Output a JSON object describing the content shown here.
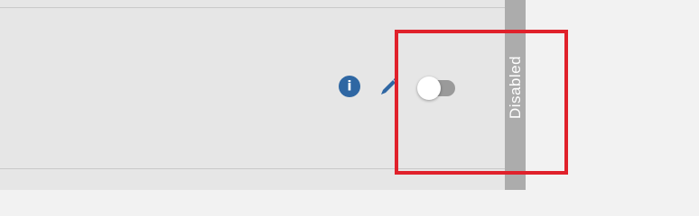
{
  "row": {
    "actions": {
      "info_icon": "info-icon",
      "edit_icon": "pencil-icon",
      "toggle": {
        "state": "off"
      }
    }
  },
  "status": {
    "label": "Disabled"
  },
  "colors": {
    "panel_bg": "#e6e6e6",
    "page_bg": "#f2f2f2",
    "icon_blue": "#2f67a3",
    "status_strip": "#acacac",
    "toggle_track": "#9a9a9a",
    "highlight": "#e0212b"
  }
}
